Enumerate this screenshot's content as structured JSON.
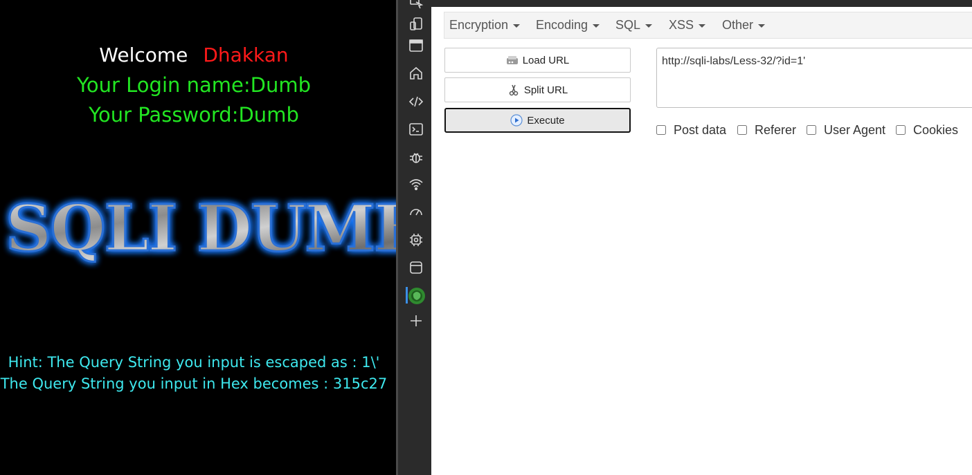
{
  "webpage": {
    "welcome_word": "Welcome",
    "welcome_user": "Dhakkan",
    "login_line": "Your Login name:Dumb",
    "password_line": "Your Password:Dumb",
    "banner_text": "SQLI DUMB",
    "hint_line": "Hint: The Query String you input is escaped as : 1\\'",
    "hex_line": "The Query String you input in Hex becomes : 315c27"
  },
  "devtools_rail": {
    "icons": [
      "inspect-icon",
      "device-emulation-icon",
      "panel-layout-icon",
      "home-icon",
      "elements-icon",
      "console-icon",
      "sources-bug-icon",
      "network-icon",
      "performance-icon",
      "memory-icon",
      "application-icon",
      "hackbar-extension-icon",
      "add-tool-icon"
    ]
  },
  "hackbar": {
    "menus": [
      {
        "label": "Encryption"
      },
      {
        "label": "Encoding"
      },
      {
        "label": "SQL"
      },
      {
        "label": "XSS"
      },
      {
        "label": "Other"
      }
    ],
    "buttons": {
      "load_url": "Load URL",
      "split_url": "Split URL",
      "execute": "Execute"
    },
    "url_value": "http://sqli-labs/Less-32/?id=1'",
    "options": {
      "post_data": "Post data",
      "referer": "Referer",
      "user_agent": "User Agent",
      "cookies": "Cookies"
    }
  },
  "colors": {
    "welcome_user": "#ff1a1a",
    "credentials": "#22e622",
    "hint": "#3ee8ee",
    "accent": "#3b8fe6"
  }
}
